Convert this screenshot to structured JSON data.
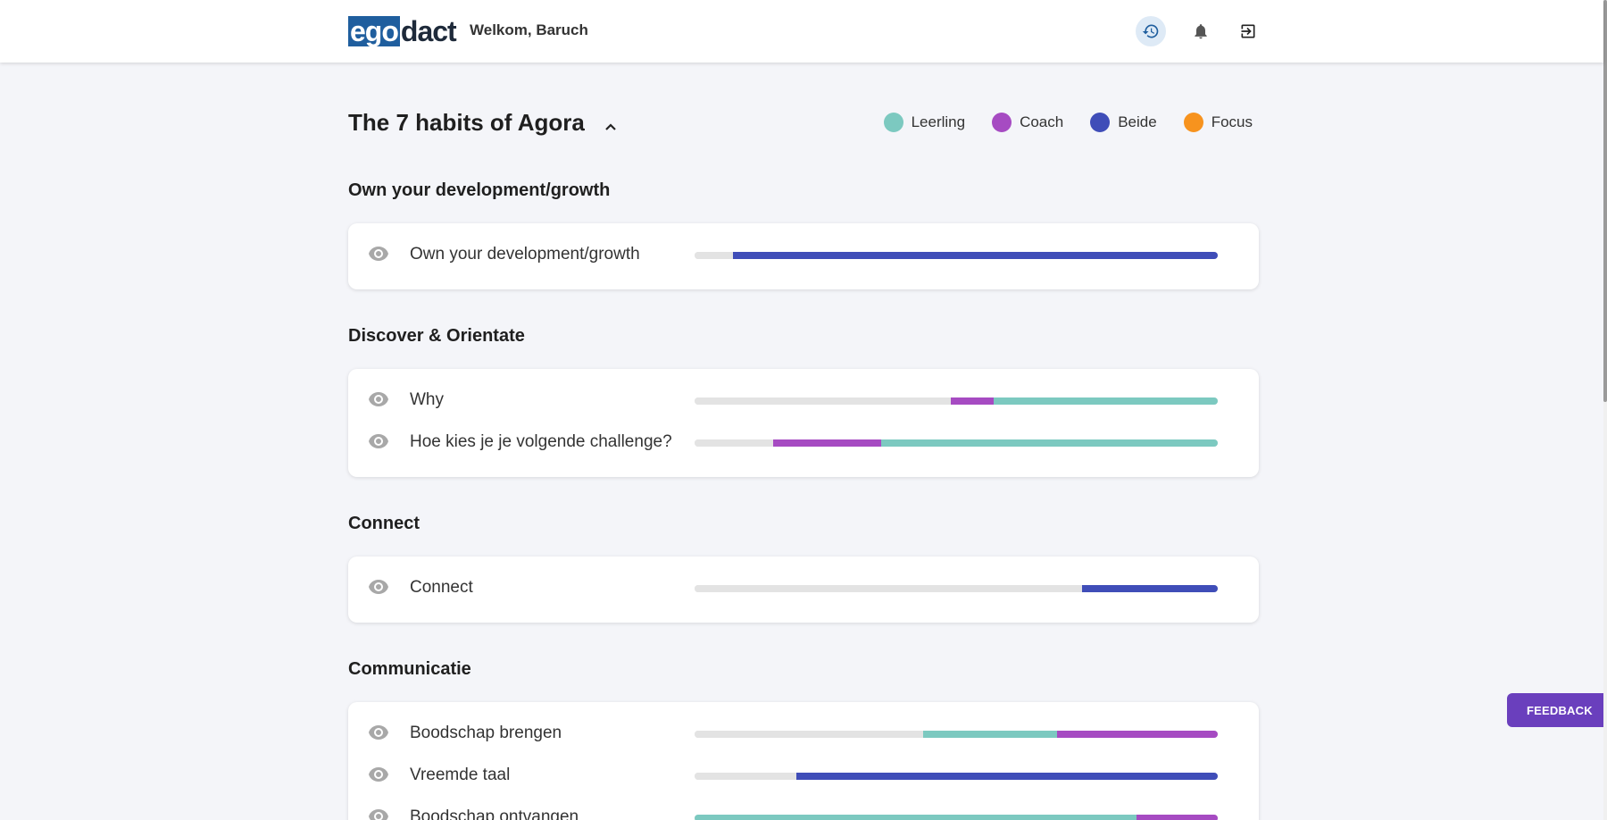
{
  "header": {
    "logo_ego": "ego",
    "logo_dact": "dact",
    "welcome": "Welkom, Baruch",
    "icons": [
      "history-icon",
      "bell-icon",
      "logout-icon"
    ]
  },
  "goal": {
    "title": "The 7 habits of Agora"
  },
  "legend": [
    {
      "label": "Leerling",
      "color": "#7cc9c0"
    },
    {
      "label": "Coach",
      "color": "#a64bc2"
    },
    {
      "label": "Beide",
      "color": "#3f4db8"
    },
    {
      "label": "Focus",
      "color": "#f7931e"
    }
  ],
  "colors": {
    "empty": "#e3e3e3",
    "leerling": "#7cc9c0",
    "coach": "#a64bc2",
    "beide": "#3f4db8"
  },
  "sections": [
    {
      "title": "Own your development/growth",
      "rows": [
        {
          "label": "Own your development/growth",
          "segments": [
            {
              "type": "empty",
              "value": 7.4
            },
            {
              "type": "beide",
              "value": 92.6
            }
          ]
        }
      ]
    },
    {
      "title": "Discover & Orientate",
      "rows": [
        {
          "label": "Why",
          "segments": [
            {
              "type": "empty",
              "value": 49
            },
            {
              "type": "coach",
              "value": 8.2
            },
            {
              "type": "leerling",
              "value": 42.8
            }
          ]
        },
        {
          "label": "Hoe kies je je volgende challenge?",
          "segments": [
            {
              "type": "empty",
              "value": 15
            },
            {
              "type": "coach",
              "value": 20.6
            },
            {
              "type": "leerling",
              "value": 64.4
            }
          ]
        }
      ]
    },
    {
      "title": "Connect",
      "rows": [
        {
          "label": "Connect",
          "segments": [
            {
              "type": "empty",
              "value": 74
            },
            {
              "type": "beide",
              "value": 26
            }
          ]
        }
      ]
    },
    {
      "title": "Communicatie",
      "rows": [
        {
          "label": "Boodschap brengen",
          "segments": [
            {
              "type": "empty",
              "value": 43.7
            },
            {
              "type": "leerling",
              "value": 25.6
            },
            {
              "type": "coach",
              "value": 30.7
            }
          ]
        },
        {
          "label": "Vreemde taal",
          "segments": [
            {
              "type": "empty",
              "value": 19.5
            },
            {
              "type": "beide",
              "value": 80.5
            }
          ]
        },
        {
          "label": "Boodschap ontvangen",
          "segments": [
            {
              "type": "leerling",
              "value": 84.5
            },
            {
              "type": "coach",
              "value": 15.5
            }
          ]
        }
      ]
    }
  ],
  "feedback_label": "FEEDBACK"
}
